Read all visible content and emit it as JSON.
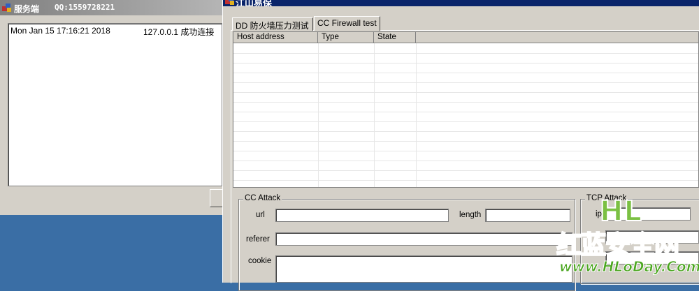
{
  "server_window": {
    "title": "服务端",
    "qq": "QQ:1559728221",
    "log": [
      {
        "time": "Mon Jan 15 17:16:21 2018",
        "message": "127.0.0.1 成功连接"
      }
    ]
  },
  "main_window": {
    "title": "江山易保",
    "tabs": [
      {
        "label": "DD 防火墙压力测试"
      },
      {
        "label": "CC Firewall test"
      }
    ],
    "list": {
      "columns": [
        "Host address",
        "Type",
        "State"
      ]
    },
    "cc_attack": {
      "group_label": "CC Attack",
      "url_label": "url",
      "length_label": "length",
      "referer_label": "referer",
      "cookie_label": "cookie"
    },
    "tcp_attack": {
      "group_label": "TCP Attack",
      "ip_label": "ip"
    }
  },
  "watermark": {
    "logo": "HL",
    "name": "红蓝安全网",
    "url": "www.HLoDay.Com"
  },
  "colors": {
    "titlebar_inactive": "#808080",
    "titlebar_active": "#0a246a",
    "window_face": "#d4d0c8",
    "desktop": "#3a6ea5",
    "watermark_green": "#33a61a"
  }
}
